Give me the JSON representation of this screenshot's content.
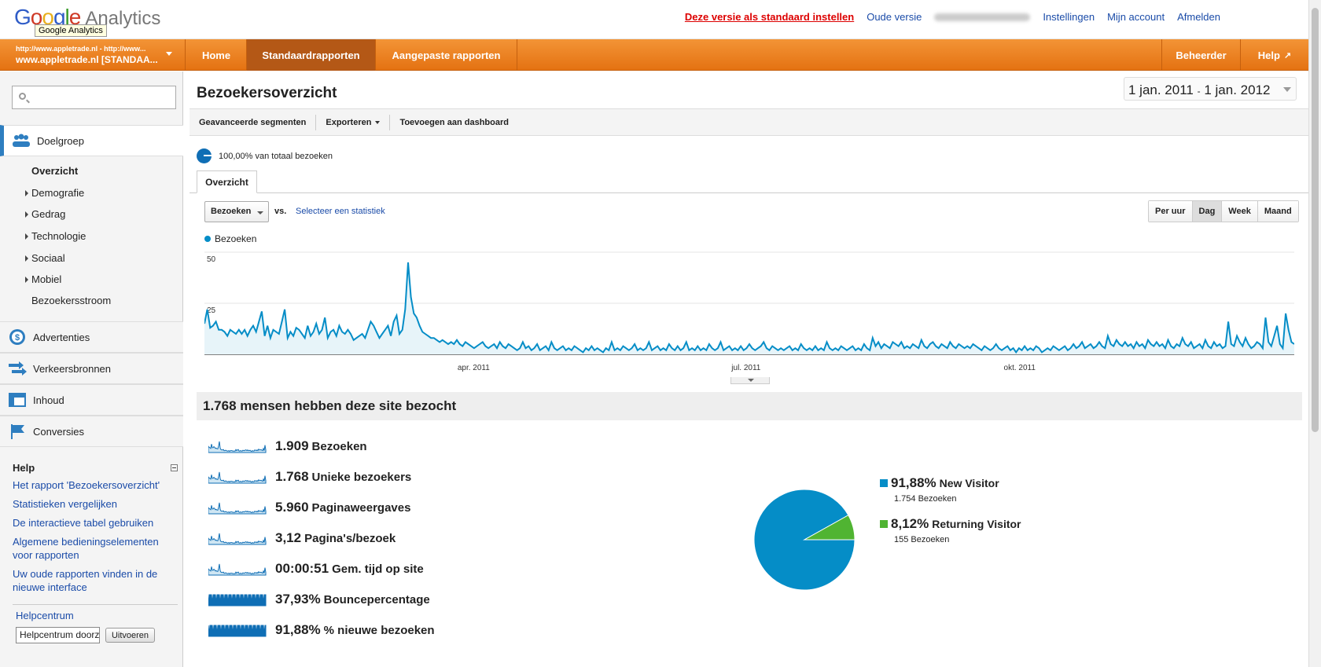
{
  "header": {
    "logo_google": "Google",
    "logo_product": "Analytics",
    "tooltip": "Google Analytics",
    "links": {
      "set_default": "Deze versie als standaard instellen",
      "old_version": "Oude versie",
      "settings": "Instellingen",
      "my_account": "Mijn account",
      "logout": "Afmelden"
    }
  },
  "nav": {
    "account_line1": "http://www.appletrade.nl - http://www...",
    "account_line2": "www.appletrade.nl [STANDAA...",
    "tabs": [
      "Home",
      "Standaardrapporten",
      "Aangepaste rapporten"
    ],
    "active_tab": "Standaardrapporten",
    "right_tabs": [
      "Beheerder",
      "Help"
    ]
  },
  "sidebar": {
    "sections": [
      {
        "label": "Doelgroep",
        "icon": "people-icon"
      },
      {
        "label": "Advertenties",
        "icon": "dollar-icon"
      },
      {
        "label": "Verkeersbronnen",
        "icon": "arrows-icon"
      },
      {
        "label": "Inhoud",
        "icon": "content-icon"
      },
      {
        "label": "Conversies",
        "icon": "flag-icon"
      }
    ],
    "subitems": [
      "Overzicht",
      "Demografie",
      "Gedrag",
      "Technologie",
      "Sociaal",
      "Mobiel",
      "Bezoekersstroom"
    ],
    "help_title": "Help",
    "help_links": [
      "Het rapport 'Bezoekersoverzicht'",
      "Statistieken vergelijken",
      "De interactieve tabel gebruiken",
      "Algemene bedieningselementen voor rapporten",
      "Uw oude rapporten vinden in de nieuwe interface"
    ],
    "helpcenter_title": "Helpcentrum",
    "helpcenter_input": "Helpcentrum doorz",
    "helpcenter_button": "Uitvoeren"
  },
  "main": {
    "title": "Bezoekersoverzicht",
    "date_from": "1 jan. 2011",
    "date_sep": "-",
    "date_to": "1 jan. 2012",
    "toolbar": [
      "Geavanceerde segmenten",
      "Exporteren",
      "Toevoegen aan dashboard"
    ],
    "segment_text": "100,00% van totaal bezoeken",
    "tab": "Overzicht",
    "metric": "Bezoeken",
    "vs": "vs.",
    "select_stat": "Selecteer een statistiek",
    "granularity": [
      "Per uur",
      "Dag",
      "Week",
      "Maand"
    ],
    "granularity_selected": "Dag",
    "summary_title": "1.768 mensen hebben deze site bezocht",
    "metrics": [
      {
        "value": "1.909",
        "label": "Bezoeken"
      },
      {
        "value": "1.768",
        "label": "Unieke bezoekers"
      },
      {
        "value": "5.960",
        "label": "Paginaweergaves"
      },
      {
        "value": "3,12",
        "label": "Pagina's/bezoek"
      },
      {
        "value": "00:00:51",
        "label": "Gem. tijd op site"
      },
      {
        "value": "37,93%",
        "label": "Bouncepercentage"
      },
      {
        "value": "91,88%",
        "label": "% nieuwe bezoeken"
      }
    ],
    "pie_legend": [
      {
        "pct": "91,88%",
        "name": "New Visitor",
        "count": "1.754 Bezoeken",
        "color": "#058dc7"
      },
      {
        "pct": "8,12%",
        "name": "Returning Visitor",
        "count": "155 Bezoeken",
        "color": "#50b432"
      }
    ]
  },
  "chart_data": [
    {
      "type": "area",
      "series": [
        {
          "name": "Bezoeken",
          "values": [
            15,
            22,
            13,
            14,
            16,
            12,
            12,
            11,
            9,
            12,
            11,
            10,
            12,
            10,
            12,
            9,
            12,
            14,
            11,
            16,
            21,
            9,
            14,
            8,
            12,
            11,
            10,
            16,
            22,
            8,
            11,
            9,
            13,
            12,
            10,
            8,
            14,
            9,
            11,
            15,
            10,
            12,
            18,
            8,
            11,
            12,
            9,
            14,
            11,
            10,
            12,
            10,
            7,
            8,
            9,
            10,
            8,
            12,
            16,
            14,
            11,
            8,
            10,
            12,
            14,
            9,
            16,
            19,
            10,
            12,
            22,
            45,
            28,
            20,
            18,
            14,
            11,
            10,
            9,
            8,
            8,
            7,
            6,
            7,
            6,
            5,
            6,
            5,
            7,
            5,
            4,
            6,
            5,
            4,
            3,
            4,
            5,
            6,
            4,
            3,
            4,
            5,
            3,
            6,
            4,
            3,
            5,
            4,
            3,
            2,
            3,
            6,
            3,
            4,
            2,
            3,
            5,
            2,
            3,
            4,
            2,
            6,
            3,
            2,
            3,
            4,
            2,
            3,
            2,
            4,
            3,
            2,
            1,
            3,
            2,
            4,
            2,
            3,
            2,
            1,
            3,
            2,
            6,
            2,
            3,
            2,
            4,
            3,
            2,
            3,
            5,
            2,
            3,
            2,
            3,
            6,
            2,
            3,
            4,
            2,
            3,
            2,
            5,
            3,
            2,
            4,
            2,
            3,
            6,
            2,
            3,
            2,
            4,
            2,
            3,
            2,
            5,
            3,
            2,
            3,
            6,
            2,
            3,
            4,
            2,
            3,
            2,
            4,
            2,
            3,
            5,
            3,
            2,
            3,
            4,
            6,
            3,
            2,
            4,
            3,
            2,
            3,
            2,
            3,
            4,
            2,
            3,
            2,
            5,
            3,
            2,
            3,
            2,
            4,
            2,
            3,
            2,
            6,
            3,
            2,
            3,
            2,
            4,
            3,
            2,
            3,
            4,
            2,
            3,
            2,
            5,
            3,
            2,
            8,
            4,
            6,
            3,
            5,
            4,
            3,
            6,
            5,
            4,
            6,
            3,
            4,
            3,
            5,
            4,
            3,
            7,
            4,
            3,
            5,
            6,
            4,
            3,
            5,
            4,
            3,
            6,
            4,
            3,
            5,
            4,
            3,
            4,
            3,
            5,
            4,
            3,
            2,
            4,
            3,
            2,
            3,
            5,
            3,
            2,
            3,
            4,
            2,
            3,
            1,
            3,
            2,
            4,
            2,
            3,
            2,
            4,
            3,
            1,
            2,
            3,
            2,
            4,
            3,
            2,
            3,
            4,
            2,
            3,
            5,
            3,
            4,
            6,
            3,
            4,
            5,
            3,
            4,
            6,
            4,
            3,
            9,
            5,
            4,
            7,
            5,
            4,
            6,
            4,
            5,
            3,
            6,
            4,
            5,
            3,
            7,
            5,
            4,
            6,
            4,
            5,
            3,
            7,
            4,
            3,
            5,
            4,
            8,
            5,
            4,
            6,
            3,
            4,
            5,
            3,
            7,
            4,
            3,
            6,
            4,
            5,
            3,
            4,
            16,
            5,
            4,
            9,
            6,
            4,
            8,
            5,
            3,
            4,
            6,
            5,
            3,
            18,
            6,
            4,
            9,
            14,
            5,
            3,
            20,
            12,
            6,
            5
          ]
        }
      ],
      "x_ticks": [
        "apr. 2011",
        "jul. 2011",
        "okt. 2011"
      ],
      "y_ticks": [
        "25",
        "50"
      ],
      "ylim": [
        0,
        50
      ]
    },
    {
      "type": "pie",
      "categories": [
        "New Visitor",
        "Returning Visitor"
      ],
      "values": [
        91.88,
        8.12
      ]
    }
  ]
}
